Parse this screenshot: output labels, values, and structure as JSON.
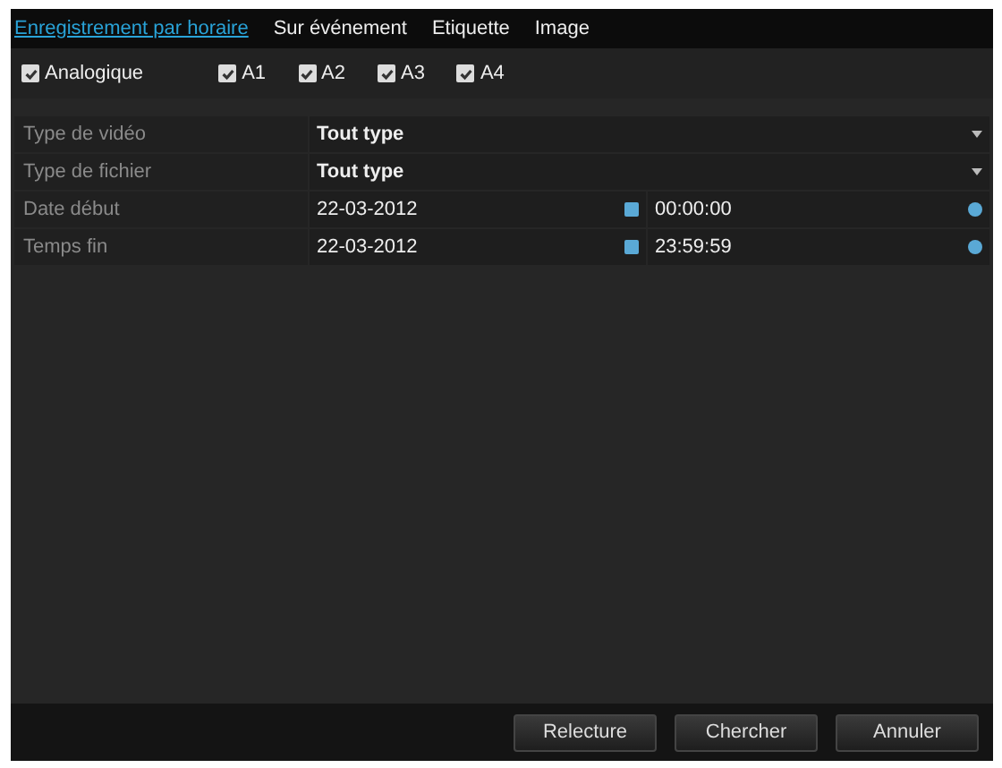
{
  "tabs": [
    {
      "label": "Enregistrement par horaire",
      "selected": true
    },
    {
      "label": "Sur événement",
      "selected": false
    },
    {
      "label": "Etiquette",
      "selected": false
    },
    {
      "label": "Image",
      "selected": false
    }
  ],
  "channels": [
    {
      "label": "Analogique",
      "checked": true
    },
    {
      "label": "A1",
      "checked": true
    },
    {
      "label": "A2",
      "checked": true
    },
    {
      "label": "A3",
      "checked": true
    },
    {
      "label": "A4",
      "checked": true
    }
  ],
  "fields": [
    {
      "kind": "select",
      "label": "Type de vidéo",
      "value": "Tout type"
    },
    {
      "kind": "select",
      "label": "Type de fichier",
      "value": "Tout type"
    },
    {
      "kind": "datetime",
      "label": "Date début",
      "date": "22-03-2012",
      "time": "00:00:00"
    },
    {
      "kind": "datetime",
      "label": "Temps fin",
      "date": "22-03-2012",
      "time": "23:59:59"
    }
  ],
  "buttons": [
    "Relecture",
    "Chercher",
    "Annuler"
  ]
}
